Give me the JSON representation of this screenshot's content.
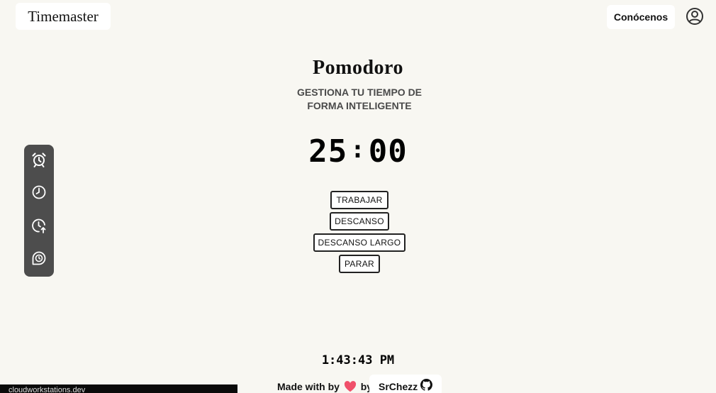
{
  "header": {
    "brand": "Timemaster",
    "about_label": "Conócenos",
    "user_icon": "user-circle-icon"
  },
  "main": {
    "title": "Pomodoro",
    "subtitle": "GESTIONA TU TIEMPO DE FORMA INTELIGENTE",
    "timer": {
      "minutes": "25",
      "separator": ":",
      "seconds": "00"
    },
    "buttons": {
      "work": "TRABAJAR",
      "break": "DESCANSO",
      "long_break": "DESCANSO LARGO",
      "stop": "PARAR"
    }
  },
  "sidebar": {
    "items": [
      {
        "icon": "alarm-clock-icon"
      },
      {
        "icon": "clock-icon"
      },
      {
        "icon": "clock-arrow-up-icon"
      },
      {
        "icon": "stopwatch-icon"
      }
    ]
  },
  "footer": {
    "current_time": "1:43:43 PM",
    "made_with": "Made with",
    "by": "by",
    "by_2": "by",
    "author": "SrChezz",
    "heart_color": "#f0506a",
    "github_icon": "github-icon"
  },
  "status_bar": {
    "text": "cloudworkstations.dev"
  },
  "colors": {
    "background": "#f8f7f2",
    "sidebar": "#4d4d4d"
  }
}
